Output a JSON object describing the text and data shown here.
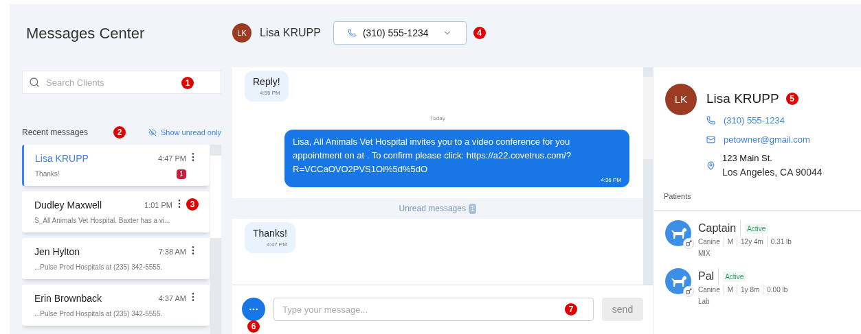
{
  "header": {
    "title": "Messages Center",
    "client": {
      "initials": "LK",
      "name": "Lisa KRUPP"
    },
    "phone": {
      "value": "(310) 555-1234",
      "callout": "4"
    }
  },
  "search": {
    "placeholder": "Search Clients",
    "callout": "1"
  },
  "recent": {
    "label": "Recent messages",
    "callout": "2",
    "filter": "Show unread only"
  },
  "conversations": [
    {
      "name": "Lisa KRUPP",
      "time": "4:47 PM",
      "preview": "Thanks!",
      "selected": true,
      "unread": "1"
    },
    {
      "name": "Dudley Maxwell",
      "time": "1:01 PM",
      "preview": "S_All Animals Vet Hospital. Baxter has a vi...",
      "selected": false,
      "callout": "3"
    },
    {
      "name": "Jen Hylton",
      "time": "7:38 AM",
      "preview": "...Pulse Prod Hospitals at (235) 342-5555.",
      "selected": false
    },
    {
      "name": "Erin Brownback",
      "time": "4:37 AM",
      "preview": "...Pulse Prod Hospitals at (235) 342-5555.",
      "selected": false
    }
  ],
  "messages": [
    {
      "kind": "incoming",
      "text": "Reply!",
      "time": "4:55 PM"
    },
    {
      "kind": "date",
      "text": "Today"
    },
    {
      "kind": "outgoing",
      "text": "Lisa, All Animals Vet Hospital invites you to a video conference for you appointment on at . To confirm please click: https://a22.covetrus.com/?R=VCCaOVO2PVS1Oi%5d%5dO",
      "time": "4:36 PM"
    },
    {
      "kind": "unread",
      "text": "Unread messages",
      "count": "1"
    },
    {
      "kind": "incoming",
      "text": "Thanks!",
      "time": "4:47 PM"
    }
  ],
  "composer": {
    "more_callout": "6",
    "placeholder": "Type your message...",
    "callout": "7",
    "send": "send"
  },
  "contact": {
    "initials": "LK",
    "name": "Lisa KRUPP",
    "callout": "5",
    "phone": "(310) 555-1234",
    "email": "petowner@gmail.com",
    "address_line1": "123 Main St.",
    "address_line2": "Los Angeles, CA 90044"
  },
  "patients_label": "Patients",
  "patients": [
    {
      "name": "Captain",
      "status": "Active",
      "details": [
        "Canine",
        "M",
        "12y 4m",
        "0.31 lb"
      ],
      "breed": "MIX"
    },
    {
      "name": "Pal",
      "status": "Active",
      "details": [
        "Canine",
        "M",
        "1y 8m",
        "0.00 lb"
      ],
      "breed": "Lab"
    }
  ]
}
